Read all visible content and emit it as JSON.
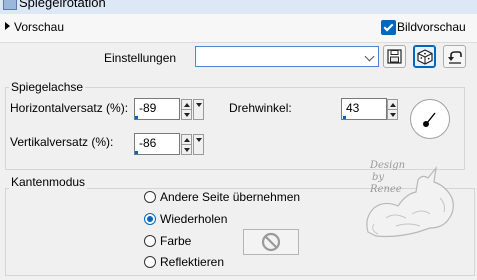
{
  "window": {
    "title": "Spiegelrotation"
  },
  "preview": {
    "label": "Vorschau",
    "live_preview_label": "Bildvorschau",
    "live_preview_checked": true
  },
  "settings": {
    "label": "Einstellungen",
    "preset_value": ""
  },
  "toolbar": {
    "save_icon": "floppy-disk-icon",
    "randomize_icon": "dice-icon",
    "reset_icon": "reset-arrow-icon"
  },
  "mirror_axis": {
    "title": "Spiegelachse",
    "horizontal_offset": {
      "label": "Horizontalversatz (%):",
      "value": "-89"
    },
    "vertical_offset": {
      "label": "Vertikalversatz (%):",
      "value": "-86"
    },
    "rotation_angle": {
      "label": "Drehwinkel:",
      "value": "43"
    }
  },
  "edge_mode": {
    "title": "Kantenmodus",
    "options": [
      {
        "label": "Andere Seite übernehmen",
        "selected": false
      },
      {
        "label": "Wiederholen",
        "selected": true
      },
      {
        "label": "Farbe",
        "selected": false
      },
      {
        "label": "Reflektieren",
        "selected": false
      }
    ],
    "color_icon": "no-color-icon"
  },
  "watermark": {
    "lines": [
      "Design",
      "by",
      "Renee"
    ]
  },
  "colors": {
    "accent": "#0067c0",
    "window_bg": "#f0f0f0",
    "border": "#d5d5d5"
  }
}
